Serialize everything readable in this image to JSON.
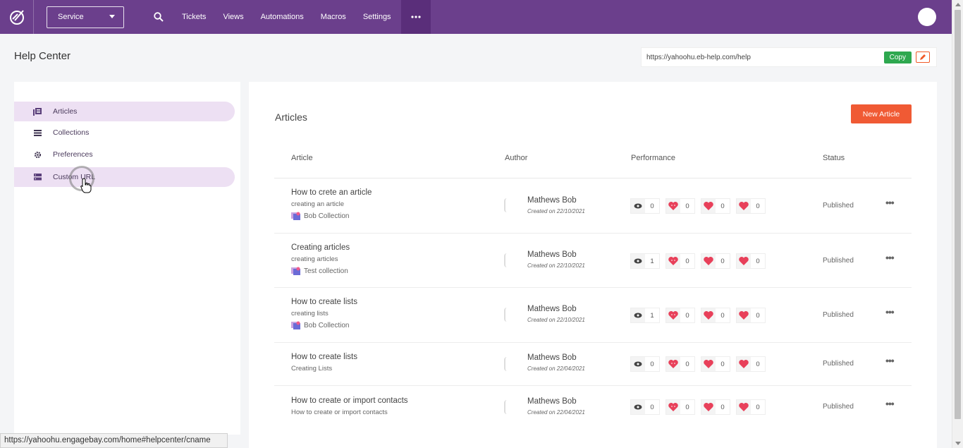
{
  "nav": {
    "service_label": "Service",
    "links": [
      "Tickets",
      "Views",
      "Automations",
      "Macros",
      "Settings"
    ]
  },
  "page": {
    "title": "Help Center",
    "url": "https://yahoohu.eb-help.com/help",
    "copy_label": "Copy"
  },
  "sidebar": {
    "items": [
      {
        "label": "Articles",
        "icon": "articles-icon",
        "active": true
      },
      {
        "label": "Collections",
        "icon": "list-icon",
        "active": false
      },
      {
        "label": "Preferences",
        "icon": "gear-icon",
        "active": false
      },
      {
        "label": "Custom URL",
        "icon": "server-icon",
        "active": true
      }
    ]
  },
  "main": {
    "title": "Articles",
    "new_label": "New Article",
    "headers": {
      "article": "Article",
      "author": "Author",
      "performance": "Performance",
      "status": "Status"
    },
    "rows": [
      {
        "title": "How to crete an article",
        "sub": "creating an article",
        "collection": "Bob Collection",
        "author": "Mathews Bob",
        "date": "Created on 22/10/2021",
        "views": "0",
        "happy": "0",
        "neutral": "0",
        "sad": "0",
        "status": "Published"
      },
      {
        "title": "Creating articles",
        "sub": "creating articles",
        "collection": "Test collection",
        "author": "Mathews Bob",
        "date": "Created on 22/10/2021",
        "views": "1",
        "happy": "0",
        "neutral": "0",
        "sad": "0",
        "status": "Published"
      },
      {
        "title": "How to create lists",
        "sub": "creating lists",
        "collection": "Bob Collection",
        "author": "Mathews Bob",
        "date": "Created on 22/10/2021",
        "views": "1",
        "happy": "0",
        "neutral": "0",
        "sad": "0",
        "status": "Published"
      },
      {
        "title": "How to create lists",
        "sub": "Creating Lists",
        "collection": "",
        "author": "Mathews Bob",
        "date": "Created on 22/04/2021",
        "views": "0",
        "happy": "0",
        "neutral": "0",
        "sad": "0",
        "status": "Published"
      },
      {
        "title": "How to create or import contacts",
        "sub": "How to create or import contacts",
        "collection": "",
        "author": "Mathews Bob",
        "date": "Created on 22/04/2021",
        "views": "0",
        "happy": "0",
        "neutral": "0",
        "sad": "0",
        "status": "Published"
      }
    ]
  },
  "statusbar": {
    "url": "https://yahoohu.engagebay.com/home#helpcenter/cname"
  },
  "colors": {
    "nav": "#6b3f8c",
    "accent": "#f05a34",
    "copy": "#2ea84f"
  }
}
